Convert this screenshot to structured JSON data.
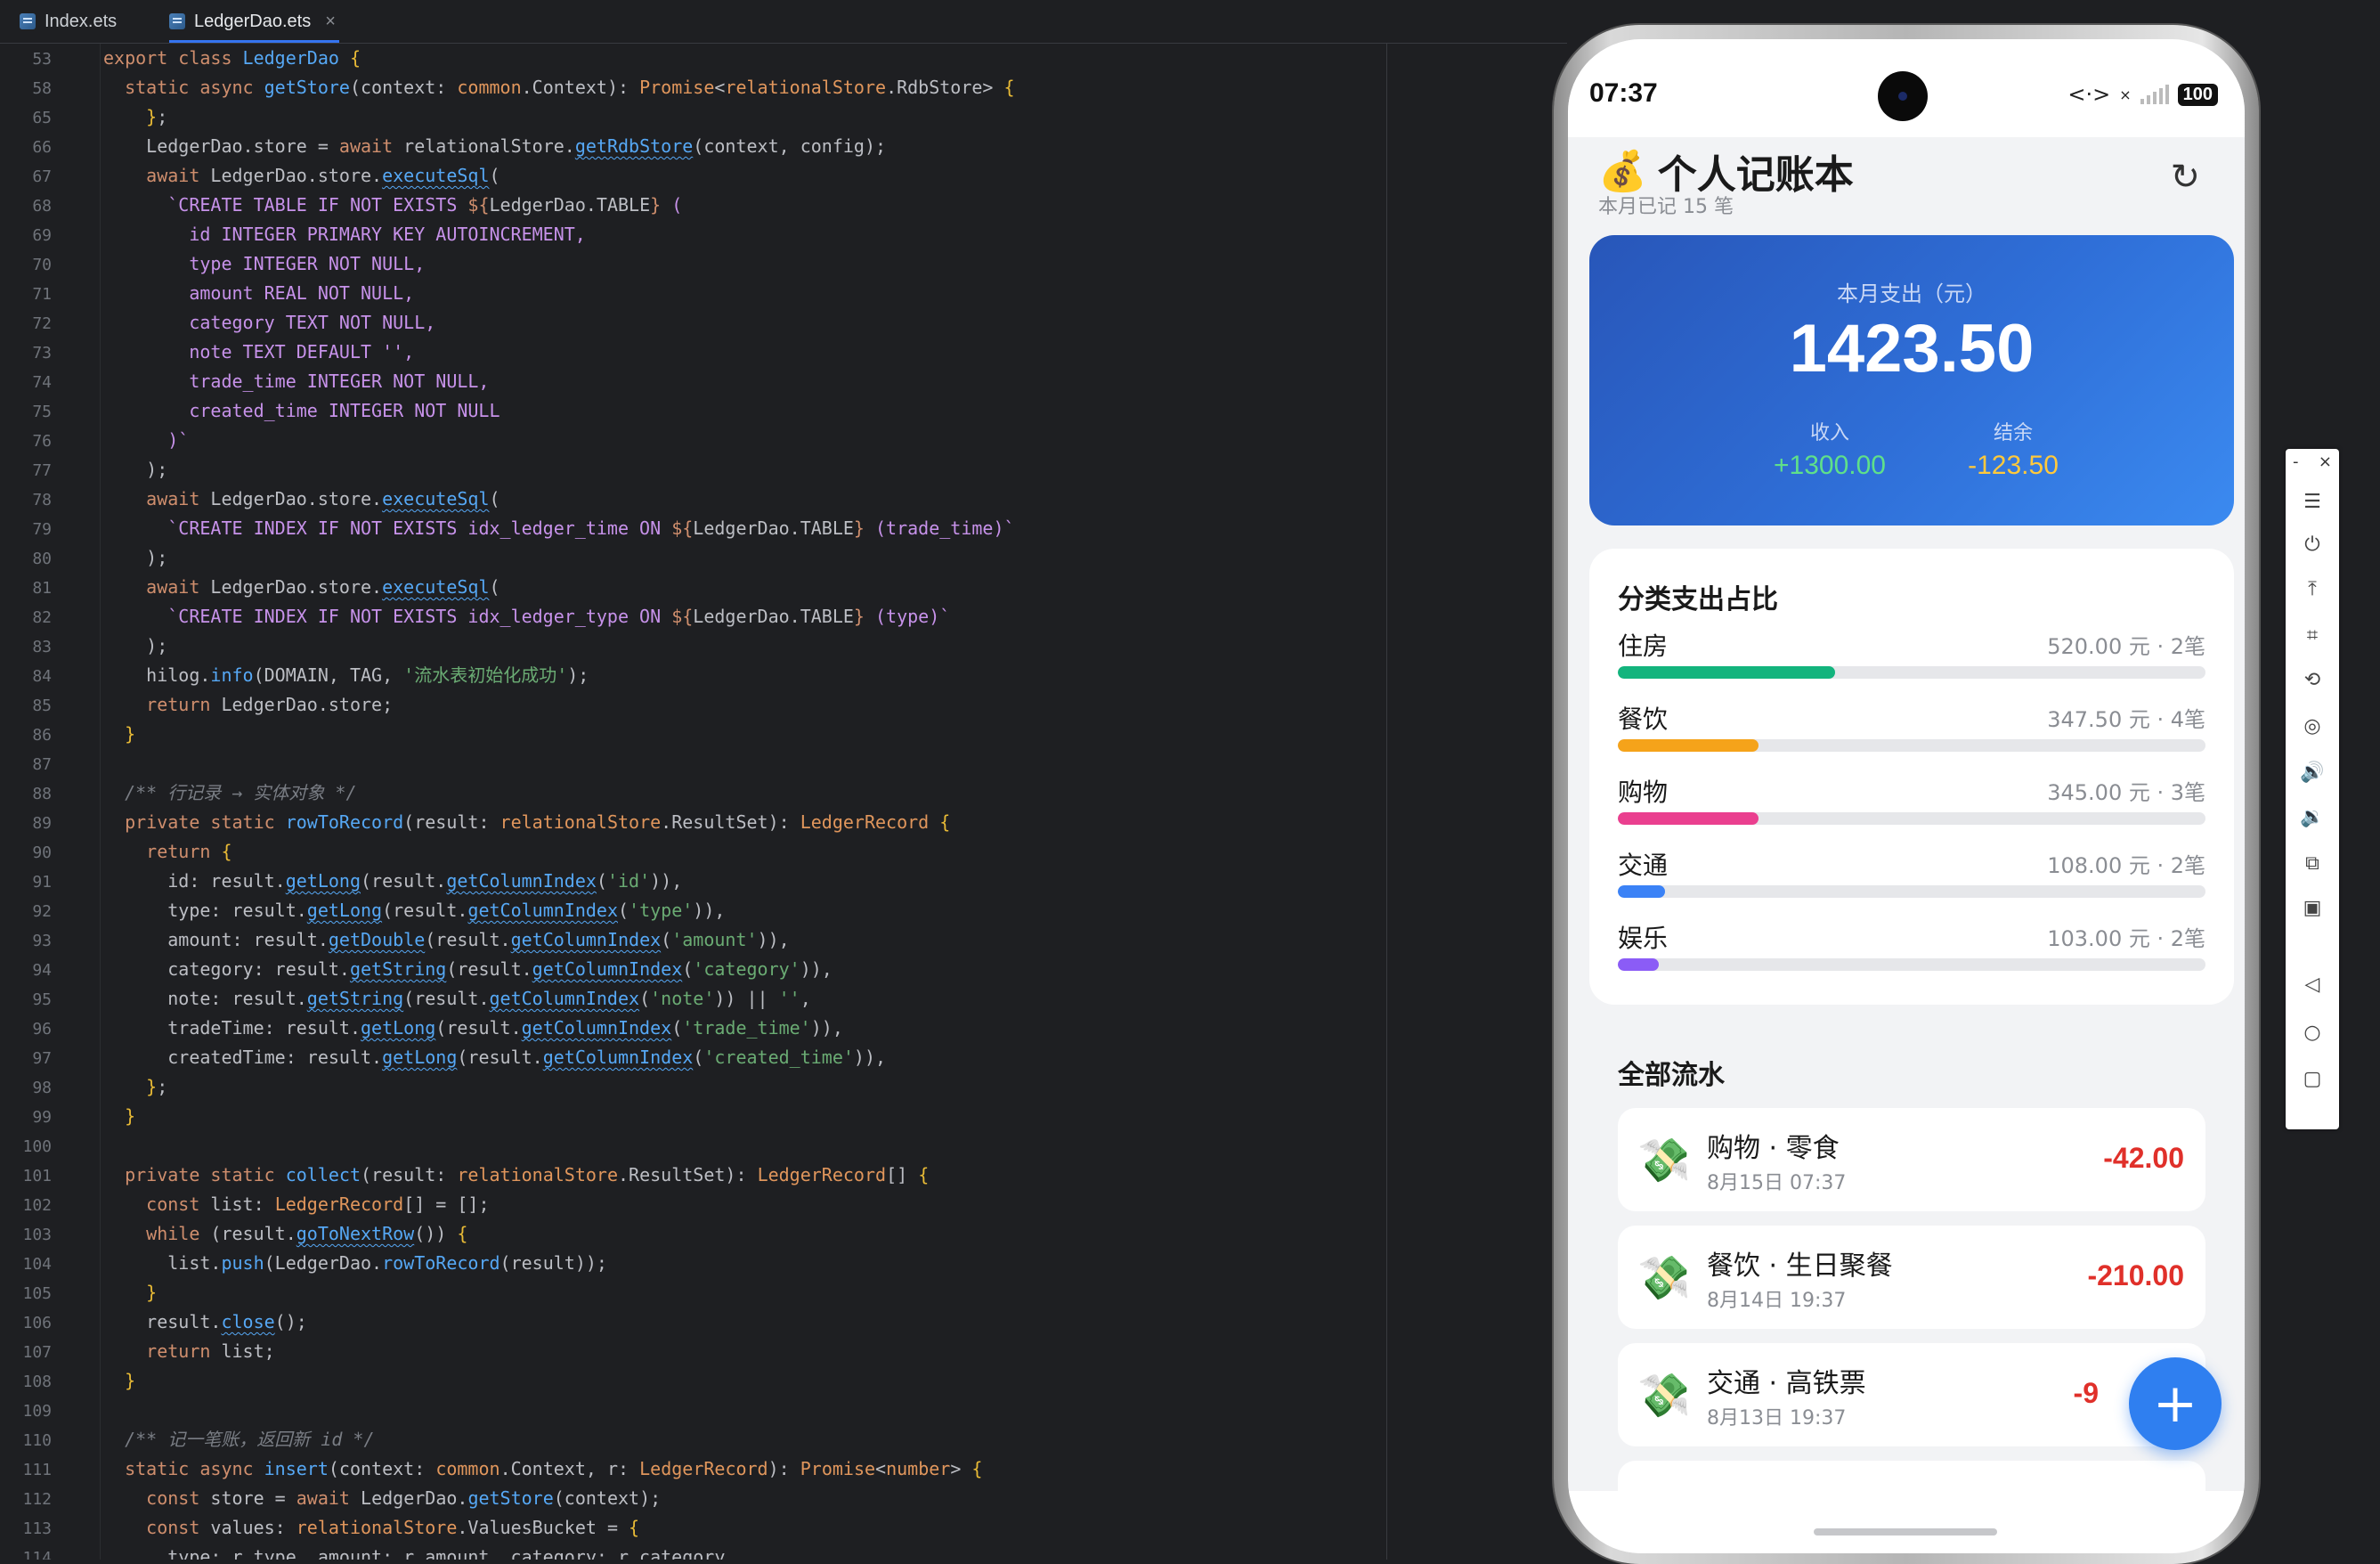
{
  "ide": {
    "tabs": [
      {
        "label": "Index.ets",
        "active": false
      },
      {
        "label": "LedgerDao.ets",
        "active": true
      }
    ],
    "tab_close": "×"
  },
  "code_lines": [
    {
      "n": "53",
      "html": "<span class='kw'>export class</span> <span class='fn'>LedgerDao</span> <span class='br'>{</span>"
    },
    {
      "n": "58",
      "html": "  <span class='kw'>static async</span> <span class='fn'>getStore</span>(context: <span class='tyo'>common</span>.Context): <span class='tyo'>Promise</span>&lt;<span class='tyo'>relationalStore</span>.RdbStore&gt; <span class='br'>{</span>"
    },
    {
      "n": "65",
      "html": "    <span class='br'>}</span>;"
    },
    {
      "n": "66",
      "html": "    LedgerDao.store = <span class='kw'>await</span> relationalStore.<span class='fnu'>getRdbStore</span>(context, config);"
    },
    {
      "n": "67",
      "html": "    <span class='kw'>await</span> LedgerDao.store.<span class='fnu'>executeSql</span>("
    },
    {
      "n": "68",
      "html": "      <span class='sql'>`CREATE TABLE IF NOT EXISTS </span><span class='kw'>${</span>LedgerDao.TABLE<span class='kw'>}</span><span class='sql'> (</span>"
    },
    {
      "n": "69",
      "html": "<span class='sql'>        id INTEGER PRIMARY KEY AUTOINCREMENT,</span>"
    },
    {
      "n": "70",
      "html": "<span class='sql'>        type INTEGER NOT NULL,</span>"
    },
    {
      "n": "71",
      "html": "<span class='sql'>        amount REAL NOT NULL,</span>"
    },
    {
      "n": "72",
      "html": "<span class='sql'>        category TEXT NOT NULL,</span>"
    },
    {
      "n": "73",
      "html": "<span class='sql'>        note TEXT DEFAULT '',</span>"
    },
    {
      "n": "74",
      "html": "<span class='sql'>        trade_time INTEGER NOT NULL,</span>"
    },
    {
      "n": "75",
      "html": "<span class='sql'>        created_time INTEGER NOT NULL</span>"
    },
    {
      "n": "76",
      "html": "<span class='sql'>      )`</span>"
    },
    {
      "n": "77",
      "html": "    );"
    },
    {
      "n": "78",
      "html": "    <span class='kw'>await</span> LedgerDao.store.<span class='fnu'>executeSql</span>("
    },
    {
      "n": "79",
      "html": "      <span class='sql'>`CREATE INDEX IF NOT EXISTS idx_ledger_time ON </span><span class='kw'>${</span>LedgerDao.TABLE<span class='kw'>}</span><span class='sql'> (trade_time)`</span>"
    },
    {
      "n": "80",
      "html": "    );"
    },
    {
      "n": "81",
      "html": "    <span class='kw'>await</span> LedgerDao.store.<span class='fnu'>executeSql</span>("
    },
    {
      "n": "82",
      "html": "      <span class='sql'>`CREATE INDEX IF NOT EXISTS idx_ledger_type ON </span><span class='kw'>${</span>LedgerDao.TABLE<span class='kw'>}</span><span class='sql'> (type)`</span>"
    },
    {
      "n": "83",
      "html": "    );"
    },
    {
      "n": "84",
      "html": "    hilog.<span class='fn'>info</span>(DOMAIN, TAG, <span class='str'>'流水表初始化成功'</span>);"
    },
    {
      "n": "85",
      "html": "    <span class='kw'>return</span> LedgerDao.store;"
    },
    {
      "n": "86",
      "html": "  <span class='br'>}</span>"
    },
    {
      "n": "87",
      "html": ""
    },
    {
      "n": "88",
      "html": "  <span class='cm'>/** 行记录 → 实体对象 */</span>"
    },
    {
      "n": "89",
      "html": "  <span class='kw'>private static</span> <span class='fn'>rowToRecord</span>(result: <span class='tyo'>relationalStore</span>.ResultSet): <span class='tyo'>LedgerRecord</span> <span class='br'>{</span>"
    },
    {
      "n": "90",
      "html": "    <span class='kw'>return</span> <span class='br'>{</span>"
    },
    {
      "n": "91",
      "html": "      id: result.<span class='fnu'>getLong</span>(result.<span class='fnu'>getColumnIndex</span>(<span class='str'>'id'</span>)),"
    },
    {
      "n": "92",
      "html": "      type: result.<span class='fnu'>getLong</span>(result.<span class='fnu'>getColumnIndex</span>(<span class='str'>'type'</span>)),"
    },
    {
      "n": "93",
      "html": "      amount: result.<span class='fnu'>getDouble</span>(result.<span class='fnu'>getColumnIndex</span>(<span class='str'>'amount'</span>)),"
    },
    {
      "n": "94",
      "html": "      category: result.<span class='fnu'>getString</span>(result.<span class='fnu'>getColumnIndex</span>(<span class='str'>'category'</span>)),"
    },
    {
      "n": "95",
      "html": "      note: result.<span class='fnu'>getString</span>(result.<span class='fnu'>getColumnIndex</span>(<span class='str'>'note'</span>)) || <span class='str'>''</span>,"
    },
    {
      "n": "96",
      "html": "      tradeTime: result.<span class='fnu'>getLong</span>(result.<span class='fnu'>getColumnIndex</span>(<span class='str'>'trade_time'</span>)),"
    },
    {
      "n": "97",
      "html": "      createdTime: result.<span class='fnu'>getLong</span>(result.<span class='fnu'>getColumnIndex</span>(<span class='str'>'created_time'</span>)),"
    },
    {
      "n": "98",
      "html": "    <span class='br'>}</span>;"
    },
    {
      "n": "99",
      "html": "  <span class='br'>}</span>"
    },
    {
      "n": "100",
      "html": ""
    },
    {
      "n": "101",
      "html": "  <span class='kw'>private static</span> <span class='fn'>collect</span>(result: <span class='tyo'>relationalStore</span>.ResultSet): <span class='tyo'>LedgerRecord</span>[] <span class='br'>{</span>"
    },
    {
      "n": "102",
      "html": "    <span class='kw'>const</span> list: <span class='tyo'>LedgerRecord</span>[] = [];"
    },
    {
      "n": "103",
      "html": "    <span class='kw'>while</span> (result.<span class='fnu'>goToNextRow</span>()) <span class='br'>{</span>"
    },
    {
      "n": "104",
      "html": "      list.<span class='fn'>push</span>(LedgerDao.<span class='fn'>rowToRecord</span>(result));"
    },
    {
      "n": "105",
      "html": "    <span class='br'>}</span>"
    },
    {
      "n": "106",
      "html": "    result.<span class='fnu'>close</span>();"
    },
    {
      "n": "107",
      "html": "    <span class='kw'>return</span> list;"
    },
    {
      "n": "108",
      "html": "  <span class='br'>}</span>"
    },
    {
      "n": "109",
      "html": ""
    },
    {
      "n": "110",
      "html": "  <span class='cm'>/** 记一笔账，返回新 id */</span>"
    },
    {
      "n": "111",
      "html": "  <span class='kw'>static async</span> <span class='fn'>insert</span>(context: <span class='tyo'>common</span>.Context, r: <span class='tyo'>LedgerRecord</span>): <span class='tyo'>Promise</span>&lt;<span class='tyo'>number</span>&gt; <span class='br'>{</span>"
    },
    {
      "n": "112",
      "html": "    <span class='kw'>const</span> store = <span class='kw'>await</span> LedgerDao.<span class='fn'>getStore</span>(context);"
    },
    {
      "n": "113",
      "html": "    <span class='kw'>const</span> values: <span class='tyo'>relationalStore</span>.ValuesBucket = <span class='br'>{</span>"
    },
    {
      "n": "114",
      "html": "      type: r.type, amount: r.amount, category: r.category,"
    }
  ],
  "phone": {
    "status": {
      "time": "07:37",
      "battery": "100",
      "net": "<·>",
      "x": "×"
    },
    "header": {
      "emoji": "💰",
      "title": "个人记账本",
      "subtitle": "本月已记 15 笔",
      "refresh": "↻"
    },
    "summary": {
      "label": "本月支出（元）",
      "value": "1423.50",
      "income_label": "收入",
      "income_value": "+1300.00",
      "balance_label": "结余",
      "balance_value": "-123.50"
    },
    "categories": {
      "title": "分类支出占比",
      "items": [
        {
          "name": "住房",
          "amount": "520.00 元 · 2笔",
          "fraction": 0.37,
          "color": "#13b47d"
        },
        {
          "name": "餐饮",
          "amount": "347.50 元 · 4笔",
          "fraction": 0.24,
          "color": "#f5a31a"
        },
        {
          "name": "购物",
          "amount": "345.00 元 · 3笔",
          "fraction": 0.24,
          "color": "#ea3f8f"
        },
        {
          "name": "交通",
          "amount": "108.00 元 · 2笔",
          "fraction": 0.08,
          "color": "#3b82f6"
        },
        {
          "name": "娱乐",
          "amount": "103.00 元 · 2笔",
          "fraction": 0.07,
          "color": "#8b5cf6"
        }
      ]
    },
    "flow": {
      "title": "全部流水",
      "records": [
        {
          "icon": "💸",
          "name": "购物 · 零食",
          "when": "8月15日 07:37",
          "amount": "-42.00"
        },
        {
          "icon": "💸",
          "name": "餐饮 · 生日聚餐",
          "when": "8月14日 19:37",
          "amount": "-210.00"
        },
        {
          "icon": "💸",
          "name": "交通 · 高铁票",
          "when": "8月13日 19:37",
          "amount": "-9"
        }
      ]
    },
    "fab": "+"
  },
  "emulator_toolbar": {
    "minimize": "-",
    "close": "×",
    "buttons": [
      {
        "name": "menu-icon",
        "glyph": "☰"
      },
      {
        "name": "power-icon",
        "glyph": "⏻"
      },
      {
        "name": "pin-top-icon",
        "glyph": "⤒"
      },
      {
        "name": "crop-icon",
        "glyph": "⌗"
      },
      {
        "name": "rotate-icon",
        "glyph": "⟲"
      },
      {
        "name": "location-icon",
        "glyph": "◎"
      },
      {
        "name": "volume-up-icon",
        "glyph": "🔊"
      },
      {
        "name": "volume-down-icon",
        "glyph": "🔉"
      },
      {
        "name": "fold-icon",
        "glyph": "⧉"
      },
      {
        "name": "screenshot-icon",
        "glyph": "▣"
      },
      {
        "name": "back-icon",
        "glyph": "◁"
      },
      {
        "name": "home-icon",
        "glyph": "○"
      },
      {
        "name": "recents-icon",
        "glyph": "▢"
      }
    ]
  }
}
